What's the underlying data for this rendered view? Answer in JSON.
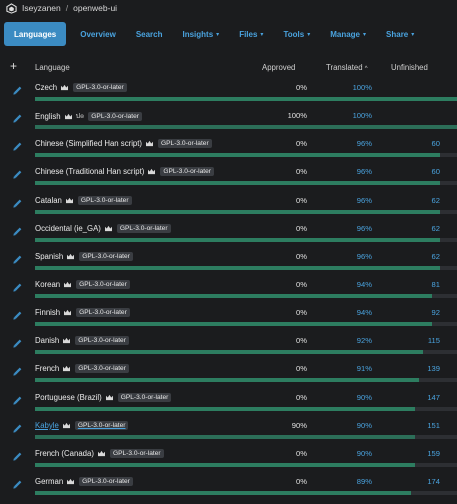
{
  "breadcrumb": {
    "owner": "Iseyzanen",
    "separator": "/",
    "project": "openweb-ui"
  },
  "nav": {
    "items": [
      {
        "label": "Languages",
        "active": true,
        "dropdown": false
      },
      {
        "label": "Overview",
        "active": false,
        "dropdown": false
      },
      {
        "label": "Search",
        "active": false,
        "dropdown": false
      },
      {
        "label": "Insights",
        "active": false,
        "dropdown": true
      },
      {
        "label": "Files",
        "active": false,
        "dropdown": true
      },
      {
        "label": "Tools",
        "active": false,
        "dropdown": true
      },
      {
        "label": "Manage",
        "active": false,
        "dropdown": true
      },
      {
        "label": "Share",
        "active": false,
        "dropdown": true
      }
    ]
  },
  "table": {
    "add_icon": "plus-icon",
    "headers": {
      "language": "Language",
      "approved": "Approved",
      "translated": "Translated",
      "sort_indicator": "^",
      "unfinished": "Unfinished"
    },
    "rows": [
      {
        "language": "Czech",
        "extra": "",
        "license": "GPL-3.0-or-later",
        "approved": "0%",
        "translated": "100%",
        "unfinished": "",
        "approved_pct": 0,
        "translated_pct": 100,
        "link": false
      },
      {
        "language": "English",
        "extra": "ป๏",
        "license": "GPL-3.0-or-later",
        "approved": "100%",
        "translated": "100%",
        "unfinished": "",
        "approved_pct": 100,
        "translated_pct": 100,
        "link": false
      },
      {
        "language": "Chinese (Simplified Han script)",
        "extra": "",
        "license": "GPL-3.0-or-later",
        "approved": "0%",
        "translated": "96%",
        "unfinished": "60",
        "approved_pct": 0,
        "translated_pct": 96,
        "link": false
      },
      {
        "language": "Chinese (Traditional Han script)",
        "extra": "",
        "license": "GPL-3.0-or-later",
        "approved": "0%",
        "translated": "96%",
        "unfinished": "60",
        "approved_pct": 0,
        "translated_pct": 96,
        "link": false
      },
      {
        "language": "Catalan",
        "extra": "",
        "license": "GPL-3.0-or-later",
        "approved": "0%",
        "translated": "96%",
        "unfinished": "62",
        "approved_pct": 0,
        "translated_pct": 96,
        "link": false
      },
      {
        "language": "Occidental (ie_GA)",
        "extra": "",
        "license": "GPL-3.0-or-later",
        "approved": "0%",
        "translated": "96%",
        "unfinished": "62",
        "approved_pct": 0,
        "translated_pct": 96,
        "link": false
      },
      {
        "language": "Spanish",
        "extra": "",
        "license": "GPL-3.0-or-later",
        "approved": "0%",
        "translated": "96%",
        "unfinished": "62",
        "approved_pct": 0,
        "translated_pct": 96,
        "link": false
      },
      {
        "language": "Korean",
        "extra": "",
        "license": "GPL-3.0-or-later",
        "approved": "0%",
        "translated": "94%",
        "unfinished": "81",
        "approved_pct": 0,
        "translated_pct": 94,
        "link": false
      },
      {
        "language": "Finnish",
        "extra": "",
        "license": "GPL-3.0-or-later",
        "approved": "0%",
        "translated": "94%",
        "unfinished": "92",
        "approved_pct": 0,
        "translated_pct": 94,
        "link": false
      },
      {
        "language": "Danish",
        "extra": "",
        "license": "GPL-3.0-or-later",
        "approved": "0%",
        "translated": "92%",
        "unfinished": "115",
        "approved_pct": 0,
        "translated_pct": 92,
        "link": false
      },
      {
        "language": "French",
        "extra": "",
        "license": "GPL-3.0-or-later",
        "approved": "0%",
        "translated": "91%",
        "unfinished": "139",
        "approved_pct": 0,
        "translated_pct": 91,
        "link": false
      },
      {
        "language": "Portuguese (Brazil)",
        "extra": "",
        "license": "GPL-3.0-or-later",
        "approved": "0%",
        "translated": "90%",
        "unfinished": "147",
        "approved_pct": 0,
        "translated_pct": 90,
        "link": false
      },
      {
        "language": "Kabyle",
        "extra": "",
        "license": "GPL-3.0-or-later",
        "approved": "90%",
        "translated": "90%",
        "unfinished": "151",
        "approved_pct": 90,
        "translated_pct": 90,
        "link": true
      },
      {
        "language": "French (Canada)",
        "extra": "",
        "license": "GPL-3.0-or-later",
        "approved": "0%",
        "translated": "90%",
        "unfinished": "159",
        "approved_pct": 0,
        "translated_pct": 90,
        "link": false
      },
      {
        "language": "German",
        "extra": "",
        "license": "GPL-3.0-or-later",
        "approved": "0%",
        "translated": "89%",
        "unfinished": "174",
        "approved_pct": 0,
        "translated_pct": 89,
        "link": false
      }
    ]
  },
  "colors": {
    "accent": "#4aa3df",
    "active_tab": "#3b8bc2",
    "bar_translated": "#2d7d60",
    "bar_approved": "#2c6e58",
    "background": "#1b1c1e"
  },
  "icons": {
    "logo": "weblate-logo-icon",
    "edit": "pencil-icon",
    "license": "crown-icon"
  }
}
